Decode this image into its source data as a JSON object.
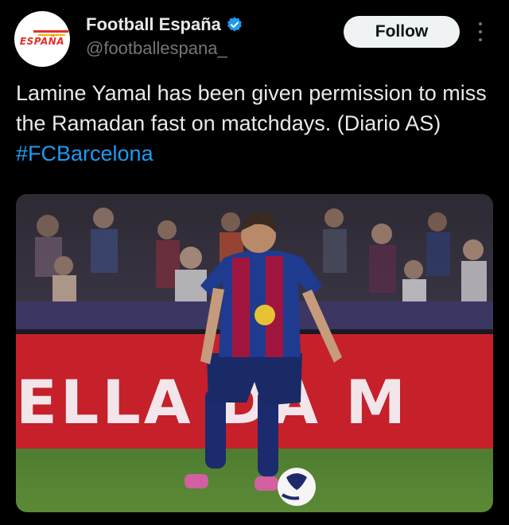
{
  "account": {
    "display_name": "Football España",
    "handle": "@footballespana_",
    "avatar_text": "ESPAÑA",
    "verified_icon": "verified-badge-icon"
  },
  "actions": {
    "follow_label": "Follow",
    "more_icon": "more-vertical-icon"
  },
  "tweet": {
    "text": "Lamine Yamal has been given permission to miss the Ramadan fast on matchdays. (Diario AS) ",
    "hashtag": "#FCBarcelona"
  },
  "media": {
    "board_text": "ELLA DA M",
    "colors": {
      "accent_link": "#1d9bf0",
      "board_red": "#c6202b",
      "jersey_blue": "#1f3b8f",
      "jersey_red": "#a0153e",
      "pitch_green": "#4e7a2e"
    }
  }
}
